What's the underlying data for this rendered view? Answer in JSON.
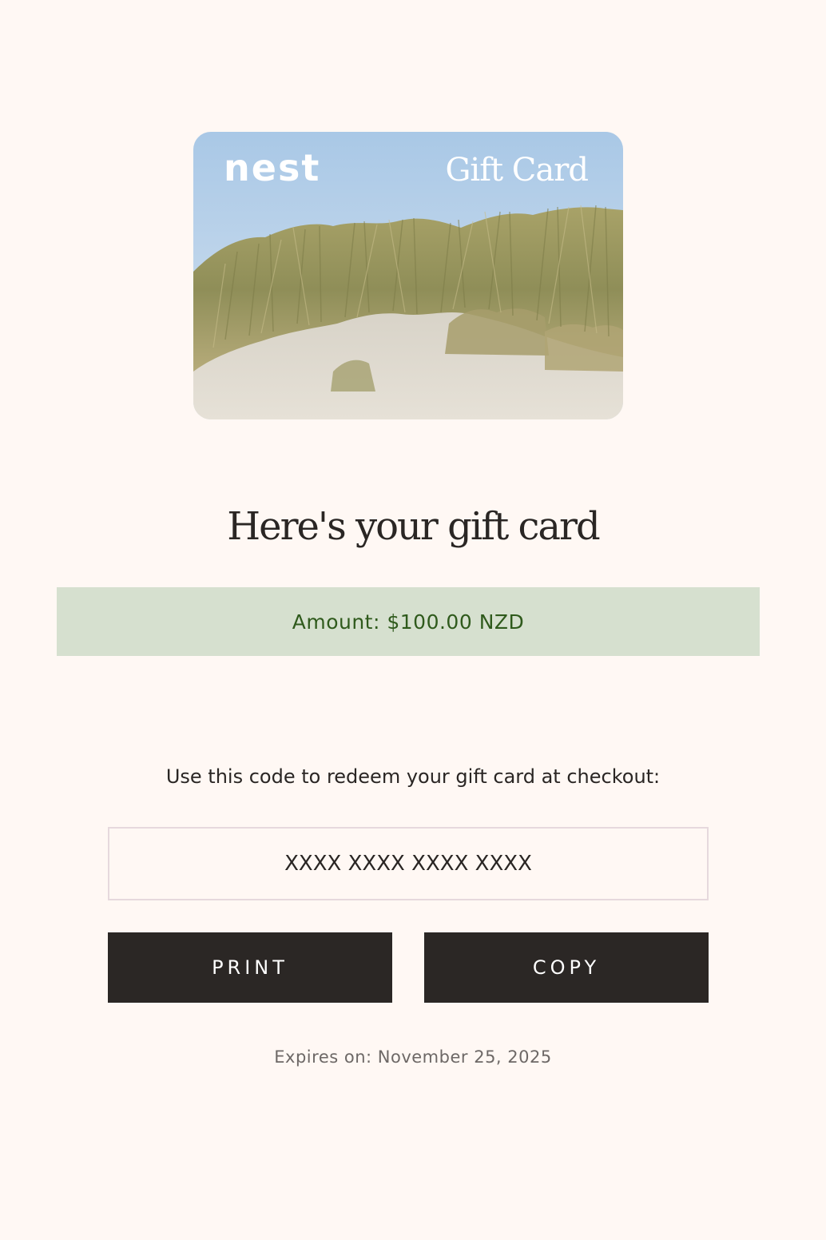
{
  "gift_card": {
    "brand": "nest",
    "label": "Gift Card"
  },
  "heading": "Here's your gift card",
  "amount": {
    "label": "Amount:",
    "value": "$100.00 NZD"
  },
  "instructions": "Use this code to redeem your gift card at checkout:",
  "code": {
    "value": "XXXX XXXX XXXX XXXX"
  },
  "buttons": {
    "print": "PRINT",
    "copy": "COPY"
  },
  "expiry": {
    "label": "Expires on:",
    "date": "November 25, 2025"
  },
  "colors": {
    "background": "#fff8f4",
    "amount_banner": "#d6e0cf",
    "amount_text": "#2f5a1c",
    "button": "#2b2725",
    "sky": "#b3cde6",
    "sand": "#dcd6cc",
    "grass": "#9a9a5e"
  }
}
